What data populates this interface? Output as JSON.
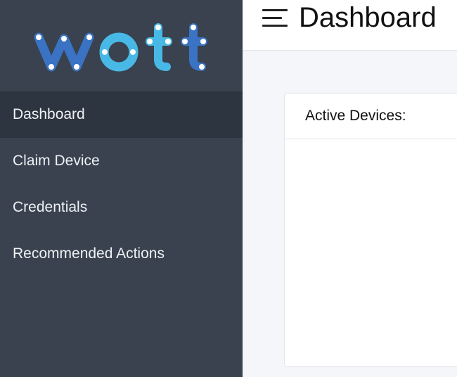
{
  "brand": {
    "logo_text": "wott",
    "logo_colors": [
      "#3a73c4",
      "#48b9e6",
      "#ffffff"
    ]
  },
  "sidebar": {
    "items": [
      {
        "label": "Dashboard",
        "active": true
      },
      {
        "label": "Claim Device",
        "active": false
      },
      {
        "label": "Credentials",
        "active": false
      },
      {
        "label": "Recommended Actions",
        "active": false
      }
    ]
  },
  "header": {
    "title": "Dashboard",
    "menu_icon": "hamburger-menu-icon"
  },
  "main": {
    "card_title": "Active Devices:"
  },
  "colors": {
    "sidebar_bg": "#39424e",
    "sidebar_active_bg": "#2d3540",
    "page_bg": "#f4f6f9"
  }
}
